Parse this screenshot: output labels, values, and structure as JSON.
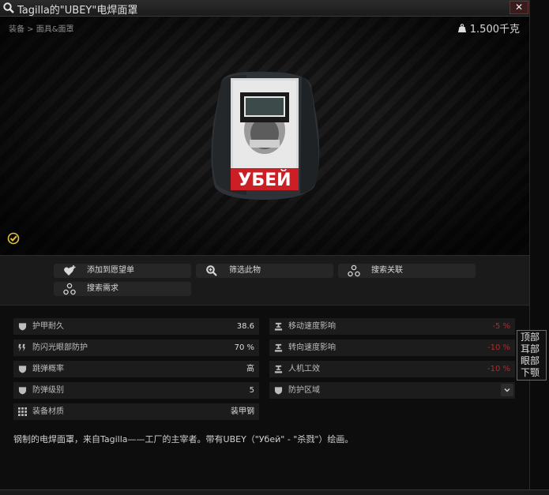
{
  "window": {
    "title": "Tagilla的\"UBEY\"电焊面罩",
    "close_glyph": "✕"
  },
  "breadcrumb": "装备 > 面具&面罩",
  "weight": "1.500千克",
  "actions": [
    {
      "label": "添加到愿望单",
      "icon": "heart-plus-icon"
    },
    {
      "label": "筛选此物",
      "icon": "magnifier-icon"
    },
    {
      "label": "搜索关联",
      "icon": "network-icon"
    },
    {
      "label": "搜索需求",
      "icon": "network-icon"
    }
  ],
  "stats_left": [
    {
      "name": "护甲耐久",
      "value": "38.6",
      "icon": "shield-icon"
    },
    {
      "name": "防闪光眼部防护",
      "value": "70 %",
      "icon": "flash-icon"
    },
    {
      "name": "跳弹概率",
      "value": "高",
      "icon": "shield-icon"
    },
    {
      "name": "防弹级别",
      "value": "5",
      "icon": "shield-icon"
    },
    {
      "name": "装备材质",
      "value": "装甲钢",
      "icon": "grid-icon"
    }
  ],
  "stats_right": [
    {
      "name": "移动速度影响",
      "value": "-5 %",
      "icon": "anvil-icon"
    },
    {
      "name": "转向速度影响",
      "value": "-10 %",
      "icon": "anvil-icon"
    },
    {
      "name": "人机工效",
      "value": "-10 %",
      "icon": "anvil-icon"
    },
    {
      "name": "防护区域",
      "value": "",
      "icon": "shield-icon"
    }
  ],
  "description": "钢制的电焊面罩，来自Tagilla——工厂的主宰者。带有UBEY（\"Убей\" - \"杀戮\"）绘画。",
  "tooltip_lines": [
    "顶部",
    "耳部",
    "眼部",
    "下颚"
  ],
  "helmet_text": "УБЕЙ",
  "colors": {
    "negative": "#b12a2a",
    "accent": "#e0c040"
  }
}
